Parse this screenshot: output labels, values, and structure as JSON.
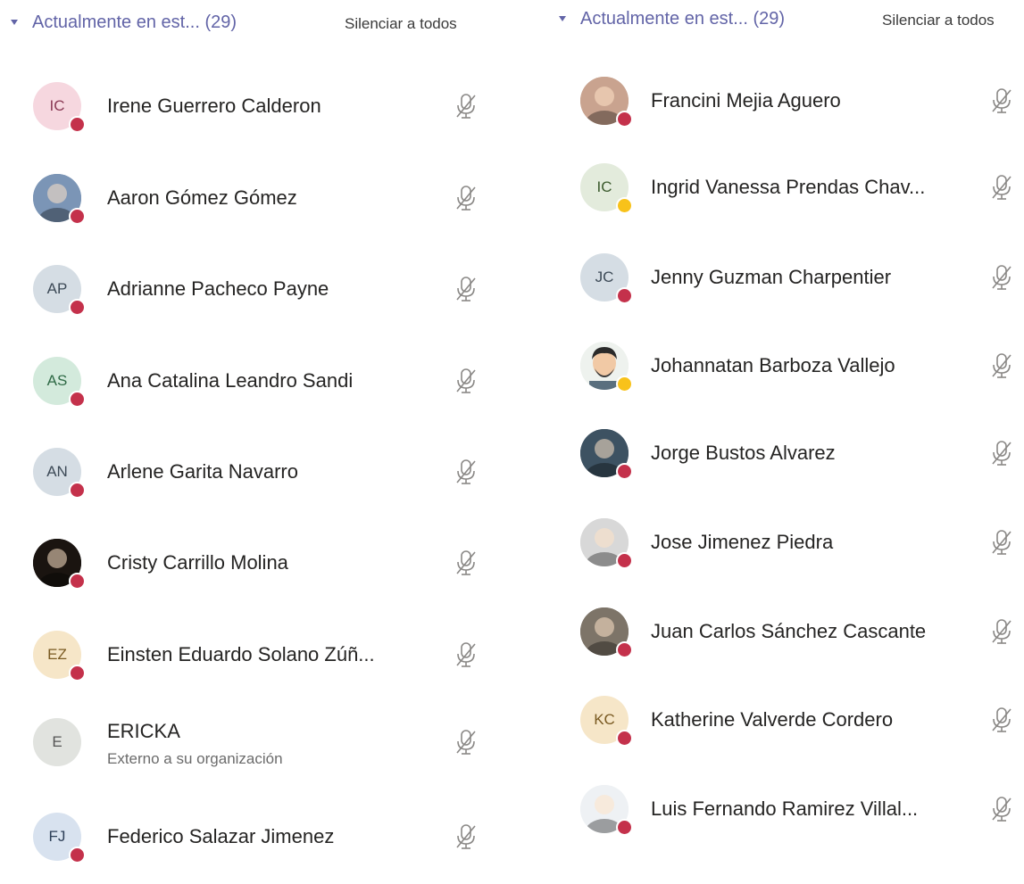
{
  "left_panel": {
    "section_title": "Actualmente en est...  (29)",
    "mute_all_label": "Silenciar a todos",
    "participants": [
      {
        "initials": "IC",
        "name": "Irene Guerrero Calderon",
        "subtitle": "",
        "status": "busy",
        "avatar_color": "#f6d7df",
        "initials_color": "#8a3a55",
        "avatar_kind": "initials"
      },
      {
        "initials": "",
        "name": "Aaron Gómez Gómez",
        "subtitle": "",
        "status": "busy",
        "avatar_color": "#7b95b6",
        "initials_color": "#444444",
        "avatar_kind": "photo"
      },
      {
        "initials": "AP",
        "name": "Adrianne Pacheco Payne",
        "subtitle": "",
        "status": "busy",
        "avatar_color": "#d5dde4",
        "initials_color": "#3d4a57",
        "avatar_kind": "initials"
      },
      {
        "initials": "AS",
        "name": "Ana Catalina Leandro Sandi",
        "subtitle": "",
        "status": "busy",
        "avatar_color": "#d3eadc",
        "initials_color": "#2f6a46",
        "avatar_kind": "initials"
      },
      {
        "initials": "AN",
        "name": "Arlene Garita Navarro",
        "subtitle": "",
        "status": "busy",
        "avatar_color": "#d5dde4",
        "initials_color": "#3d4a57",
        "avatar_kind": "initials"
      },
      {
        "initials": "",
        "name": "Cristy Carrillo Molina",
        "subtitle": "",
        "status": "busy",
        "avatar_color": "#1a1410",
        "initials_color": "#444444",
        "avatar_kind": "photo"
      },
      {
        "initials": "EZ",
        "name": "Einsten Eduardo Solano Zúñ...",
        "subtitle": "",
        "status": "busy",
        "avatar_color": "#f6e6c8",
        "initials_color": "#7a5a22",
        "avatar_kind": "initials"
      },
      {
        "initials": "E",
        "name": "ERICKA",
        "subtitle": "Externo a su organización",
        "status": "none",
        "avatar_color": "#e1e3df",
        "initials_color": "#555555",
        "avatar_kind": "initials"
      },
      {
        "initials": "FJ",
        "name": "Federico Salazar Jimenez",
        "subtitle": "",
        "status": "busy",
        "avatar_color": "#d8e2ef",
        "initials_color": "#2c3e57",
        "avatar_kind": "initials"
      }
    ]
  },
  "right_panel": {
    "section_title": "Actualmente en est...  (29)",
    "mute_all_label": "Silenciar a todos",
    "participants": [
      {
        "initials": "",
        "name": "Francini Mejia Aguero",
        "subtitle": "",
        "status": "busy",
        "avatar_color": "#c9a38f",
        "initials_color": "#444444",
        "avatar_kind": "photo"
      },
      {
        "initials": "IC",
        "name": "Ingrid Vanessa Prendas Chav...",
        "subtitle": "",
        "status": "away",
        "avatar_color": "#e3ebdc",
        "initials_color": "#3b5a2d",
        "avatar_kind": "initials"
      },
      {
        "initials": "JC",
        "name": "Jenny Guzman Charpentier",
        "subtitle": "",
        "status": "busy",
        "avatar_color": "#d5dde4",
        "initials_color": "#3d4a57",
        "avatar_kind": "initials"
      },
      {
        "initials": "",
        "name": "Johannatan Barboza Vallejo",
        "subtitle": "",
        "status": "away",
        "avatar_color": "#eef2ee",
        "initials_color": "#444444",
        "avatar_kind": "cartoon"
      },
      {
        "initials": "",
        "name": "Jorge Bustos Alvarez",
        "subtitle": "",
        "status": "busy",
        "avatar_color": "#3d5262",
        "initials_color": "#444444",
        "avatar_kind": "photo"
      },
      {
        "initials": "",
        "name": "Jose Jimenez Piedra",
        "subtitle": "",
        "status": "busy",
        "avatar_color": "#d8d8d8",
        "initials_color": "#444444",
        "avatar_kind": "photo"
      },
      {
        "initials": "",
        "name": "Juan Carlos Sánchez Cascante",
        "subtitle": "",
        "status": "busy",
        "avatar_color": "#7d7468",
        "initials_color": "#444444",
        "avatar_kind": "photo"
      },
      {
        "initials": "KC",
        "name": "Katherine Valverde Cordero",
        "subtitle": "",
        "status": "busy",
        "avatar_color": "#f6e6c8",
        "initials_color": "#7a5a22",
        "avatar_kind": "initials"
      },
      {
        "initials": "",
        "name": "Luis Fernando Ramirez Villal...",
        "subtitle": "",
        "status": "busy",
        "avatar_color": "#eef1f4",
        "initials_color": "#444444",
        "avatar_kind": "photo"
      }
    ]
  },
  "icons": {
    "chevron": "chevron-down-icon",
    "mic": "microphone-muted-icon",
    "status": "presence-status-icon"
  },
  "colors": {
    "accent": "#6264a7",
    "busy": "#c4314b",
    "away": "#f8c21a",
    "text": "#252423",
    "subtext": "#6b6b6b",
    "mic": "#8a8886"
  }
}
